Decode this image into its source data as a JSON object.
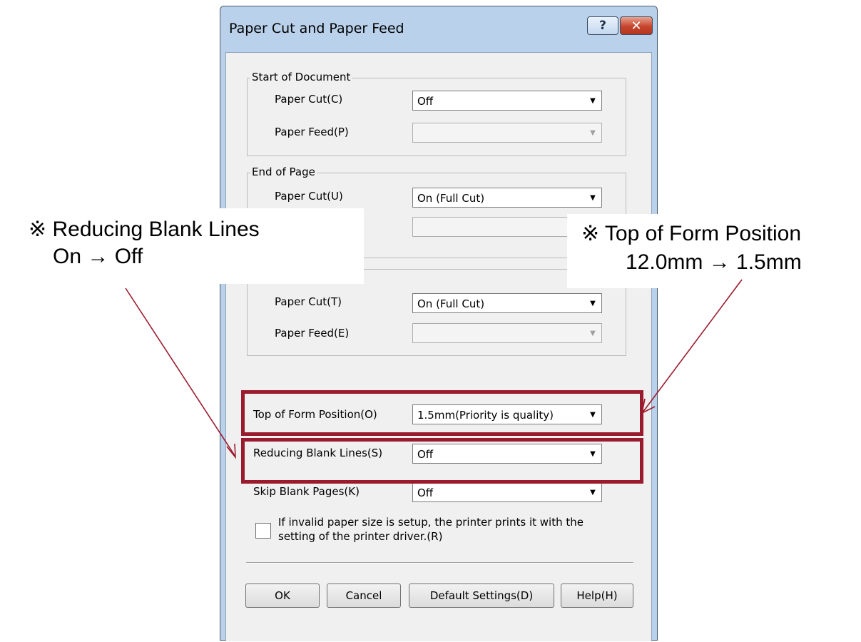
{
  "dialog": {
    "title": "Paper Cut and Paper Feed",
    "help_button": "?",
    "close_button": "✕",
    "start_of_document": {
      "label": "Start of Document",
      "paper_cut_label": "Paper Cut(C)",
      "paper_cut_value": "Off",
      "paper_feed_label": "Paper Feed(P)",
      "paper_feed_value": ""
    },
    "end_of_page": {
      "label": "End of Page",
      "paper_cut_label": "Paper Cut(U)",
      "paper_cut_value": "On (Full Cut)",
      "paper_feed_value": ""
    },
    "end_of_document": {
      "paper_cut_label": "Paper Cut(T)",
      "paper_cut_value": "On (Full Cut)",
      "paper_feed_label": "Paper Feed(E)",
      "paper_feed_value": ""
    },
    "top_of_form_label": "Top of Form Position(O)",
    "top_of_form_value": "1.5mm(Priority is quality)",
    "reducing_blank_lines_label": "Reducing Blank Lines(S)",
    "reducing_blank_lines_value": "Off",
    "skip_blank_pages_label": "Skip Blank Pages(K)",
    "skip_blank_pages_value": "Off",
    "invalid_paper_checkbox_label": "If invalid paper size is setup, the printer prints it with the setting of the printer driver.(R)",
    "invalid_paper_checked": false,
    "buttons": {
      "ok": "OK",
      "cancel": "Cancel",
      "default_settings": "Default Settings(D)",
      "help": "Help(H)"
    }
  },
  "annotations": {
    "left_line1": "※ Reducing Blank Lines",
    "left_line2": "On → Off",
    "right_line1": "※ Top of Form Position",
    "right_line2": "12.0mm → 1.5mm",
    "highlight_color": "#9b1b2e"
  }
}
